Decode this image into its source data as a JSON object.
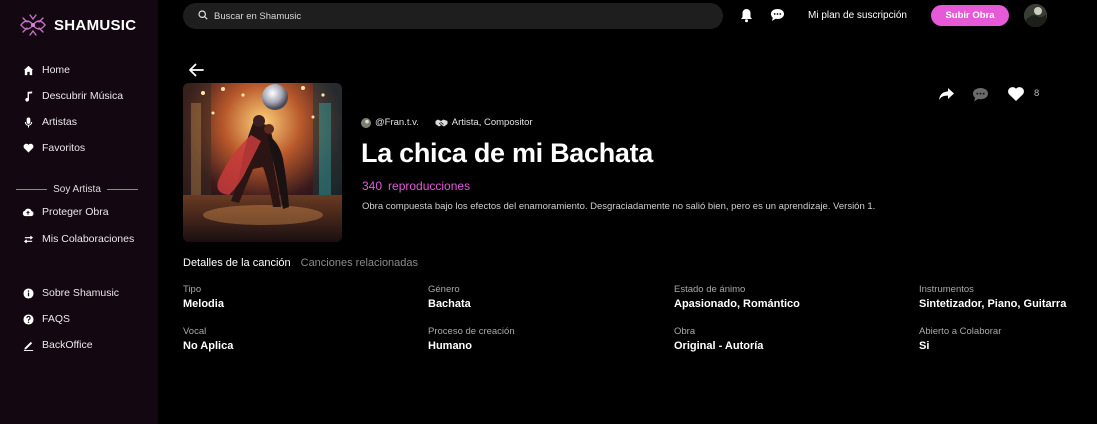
{
  "brand": {
    "name": "SHAMUSIC"
  },
  "sidebar": {
    "items": [
      {
        "label": "Home",
        "icon": "home-icon"
      },
      {
        "label": "Descubrir Música",
        "icon": "music-note-icon"
      },
      {
        "label": "Artistas",
        "icon": "microphone-icon"
      },
      {
        "label": "Favoritos",
        "icon": "heart-icon"
      }
    ],
    "section_title": "Soy Artista",
    "artist_items": [
      {
        "label": "Proteger Obra",
        "icon": "cloud-upload-icon"
      },
      {
        "label": "Mis Colaboraciones",
        "icon": "swap-icon"
      }
    ],
    "footer_items": [
      {
        "label": "Sobre Shamusic",
        "icon": "info-icon"
      },
      {
        "label": "FAQS",
        "icon": "question-icon"
      },
      {
        "label": "BackOffice",
        "icon": "pen-icon"
      }
    ]
  },
  "topbar": {
    "search_placeholder": "Buscar en Shamusic",
    "plan_label": "Mi plan de suscripción",
    "upload_label": "Subir Obra"
  },
  "song": {
    "author": "@Fran.t.v.",
    "role": "Artista, Compositor",
    "title": "La chica de mi Bachata",
    "plays_count": "340",
    "plays_label": "reproducciones",
    "description": "Obra compuesta bajo los efectos del enamoramiento. Desgraciadamente no salió bien, pero es un aprendizaje. Versión 1.",
    "likes": "8"
  },
  "tabs": [
    {
      "label": "Detalles de la canción",
      "active": true
    },
    {
      "label": "Canciones relacionadas",
      "active": false
    }
  ],
  "details": [
    {
      "label": "Tipo",
      "value": "Melodia"
    },
    {
      "label": "Género",
      "value": "Bachata"
    },
    {
      "label": "Estado de ánimo",
      "value": "Apasionado, Romántico"
    },
    {
      "label": "Instrumentos",
      "value": "Sintetizador, Piano, Guitarra"
    },
    {
      "label": "Vocal",
      "value": "No Aplica"
    },
    {
      "label": "Proceso de creación",
      "value": "Humano"
    },
    {
      "label": "Obra",
      "value": "Original - Autoría"
    },
    {
      "label": "Abierto a Colaborar",
      "value": "Si"
    }
  ],
  "colors": {
    "accent": "#e65ad7",
    "sidebar_bg": "#130712",
    "background": "#000000"
  }
}
